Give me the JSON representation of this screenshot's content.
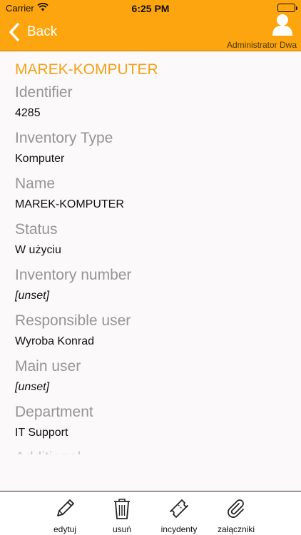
{
  "status_bar": {
    "carrier": "Carrier",
    "time": "6:25 PM"
  },
  "header": {
    "back_label": "Back",
    "user_name": "Administrator Dwa"
  },
  "record": {
    "title": "MAREK-KOMPUTER",
    "fields": [
      {
        "label": "Identifier",
        "value": "4285"
      },
      {
        "label": "Inventory Type",
        "value": "Komputer"
      },
      {
        "label": "Name",
        "value": "MAREK-KOMPUTER"
      },
      {
        "label": "Status",
        "value": "W użyciu"
      },
      {
        "label": "Inventory number",
        "value": "[unset]"
      },
      {
        "label": "Responsible user",
        "value": "Wyroba Konrad"
      },
      {
        "label": "Main user",
        "value": "[unset]"
      },
      {
        "label": "Department",
        "value": "IT Support"
      }
    ],
    "partial_label": "Additional"
  },
  "toolbar": {
    "edit_label": "edytuj",
    "delete_label": "usuń",
    "incidents_label": "incydenty",
    "attachments_label": "załączniki"
  },
  "colors": {
    "header": "#fca50e",
    "accent_title": "#f0a21a",
    "label": "#959595"
  }
}
